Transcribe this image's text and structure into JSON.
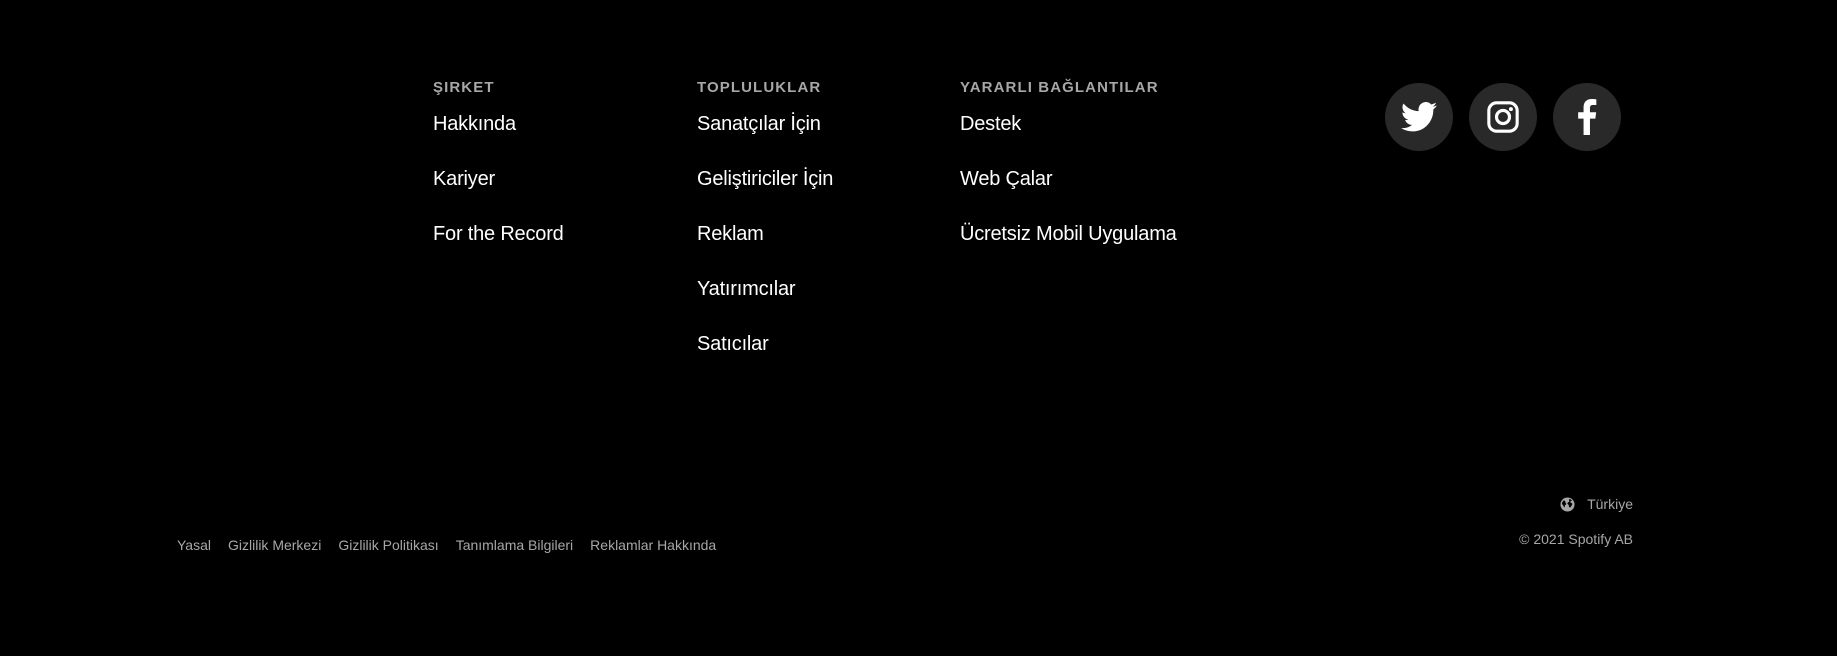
{
  "colors": {
    "background": "#000000",
    "heading": "#a7a7a7",
    "link": "#ffffff",
    "muted": "#a7a7a7",
    "social_bg": "#292929"
  },
  "columns": {
    "company": {
      "heading": "Şirket",
      "items": [
        "Hakkında",
        "Kariyer",
        "For the Record"
      ]
    },
    "communities": {
      "heading": "Topluluklar",
      "items": [
        "Sanatçılar İçin",
        "Geliştiriciler İçin",
        "Reklam",
        "Yatırımcılar",
        "Satıcılar"
      ]
    },
    "useful": {
      "heading": "Yararlı Bağlantılar",
      "items": [
        "Destek",
        "Web Çalar",
        "Ücretsiz Mobil Uygulama"
      ]
    }
  },
  "social": [
    {
      "name": "twitter",
      "icon": "twitter-icon"
    },
    {
      "name": "instagram",
      "icon": "instagram-icon"
    },
    {
      "name": "facebook",
      "icon": "facebook-icon"
    }
  ],
  "legal": {
    "items": [
      "Yasal",
      "Gizlilik Merkezi",
      "Gizlilik Politikası",
      "Tanımlama Bilgileri",
      "Reklamlar Hakkında"
    ]
  },
  "region": {
    "label": "Türkiye",
    "icon": "globe-icon"
  },
  "copyright": "© 2021 Spotify AB"
}
